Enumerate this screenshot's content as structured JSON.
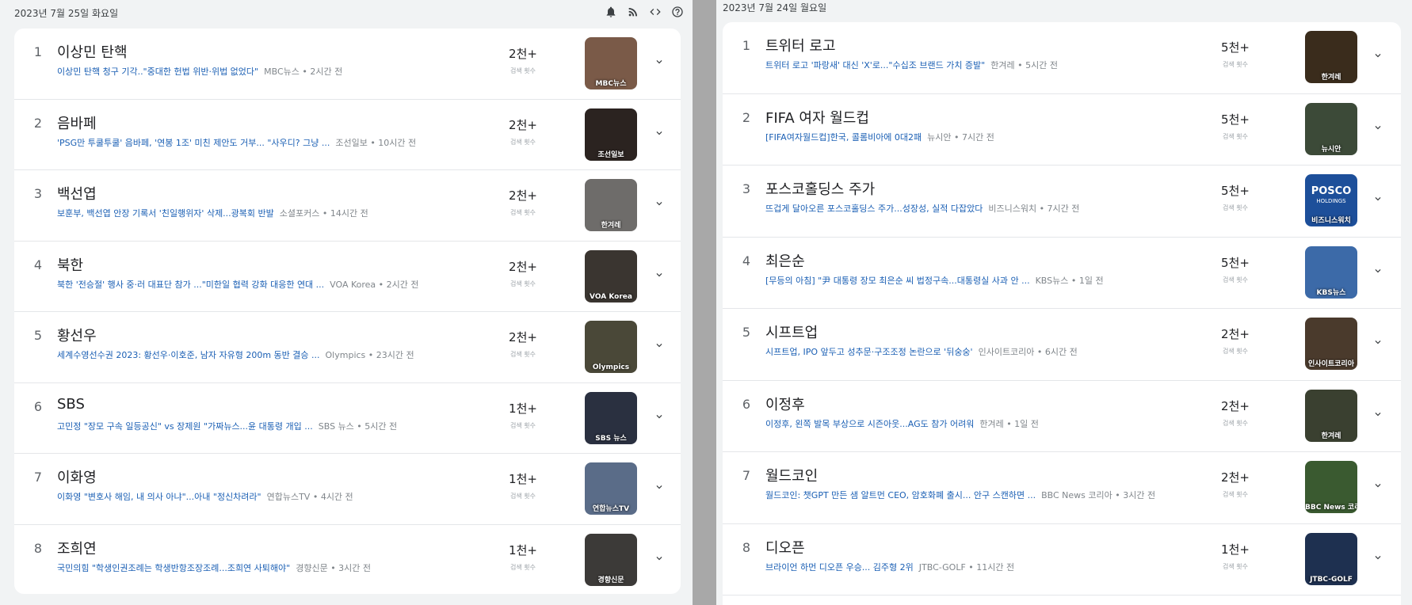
{
  "left": {
    "date": "2023년 7월 25일 화요일",
    "count_label": "검색 횟수",
    "items": [
      {
        "rank": "1",
        "title": "이상민 탄핵",
        "headline": "이상민 탄핵 청구 기각..\"중대한 헌법 위반·위법 없었다\"",
        "meta": "MBC뉴스 • 2시간 전",
        "count": "2천+",
        "thumb_source": "MBC뉴스",
        "thumb_color": "#7a5a48"
      },
      {
        "rank": "2",
        "title": "음바페",
        "headline": "'PSG만 투쿨투쿨' 음바페, '연봉 1조' 미친 제안도 거부... \"사우디? 그냥 ...",
        "meta": "조선일보 • 10시간 전",
        "count": "2천+",
        "thumb_source": "조선일보",
        "thumb_color": "#2b2320"
      },
      {
        "rank": "3",
        "title": "백선엽",
        "headline": "보훈부, 백선엽 안장 기록서 '친일행위자' 삭제...광복회 반발",
        "meta": "소셜포커스 • 14시간 전",
        "count": "2천+",
        "thumb_source": "한겨레",
        "thumb_color": "#6e6c6a"
      },
      {
        "rank": "4",
        "title": "북한",
        "headline": "북한 '전승절' 행사 중·러 대표단 참가 ...\"미한일 협력 강화 대응한 연대 ...",
        "meta": "VOA Korea • 2시간 전",
        "count": "2천+",
        "thumb_source": "VOA Korea",
        "thumb_color": "#3a3530"
      },
      {
        "rank": "5",
        "title": "황선우",
        "headline": "세계수영선수권 2023: 황선우·이호준, 남자 자유형 200m 동반 결승 ...",
        "meta": "Olympics • 23시간 전",
        "count": "2천+",
        "thumb_source": "Olympics",
        "thumb_color": "#4a4838"
      },
      {
        "rank": "6",
        "title": "SBS",
        "headline": "고민정 \"장모 구속 일등공신\" vs 장제원 \"가짜뉴스...윤 대통령 개입 ...",
        "meta": "SBS 뉴스 • 5시간 전",
        "count": "1천+",
        "thumb_source": "SBS 뉴스",
        "thumb_color": "#2a3040"
      },
      {
        "rank": "7",
        "title": "이화영",
        "headline": "이화영 \"변호사 해임, 내 의사 아냐\"...아내 \"정신차려라\"",
        "meta": "연합뉴스TV • 4시간 전",
        "count": "1천+",
        "thumb_source": "연합뉴스TV",
        "thumb_color": "#5a6c88"
      },
      {
        "rank": "8",
        "title": "조희연",
        "headline": "국민의힘 \"학생인권조례는 학생반항조장조례...조희연 사퇴해야\"",
        "meta": "경향신문 • 3시간 전",
        "count": "1천+",
        "thumb_source": "경향신문",
        "thumb_color": "#3c3a38"
      }
    ]
  },
  "right": {
    "date": "2023년 7월 24일 월요일",
    "count_label": "검색 횟수",
    "items": [
      {
        "rank": "1",
        "title": "트위터 로고",
        "headline": "트위터 로고 '파랑새' 대신 'X'로...\"수십조 브랜드 가치 증발\"",
        "meta": "한겨레 • 5시간 전",
        "count": "5천+",
        "thumb_source": "한겨레",
        "thumb_color": "#3a2c1c"
      },
      {
        "rank": "2",
        "title": "FIFA 여자 월드컵",
        "headline": "[FIFA여자월드컵]한국, 콜롬비아에 0대2패",
        "meta": "뉴시안 • 7시간 전",
        "count": "5천+",
        "thumb_source": "뉴시안",
        "thumb_color": "#3c4a38"
      },
      {
        "rank": "3",
        "title": "포스코홀딩스 주가",
        "headline": "뜨겁게 달아오른 포스코홀딩스 주가...성장성, 실적 다잡았다",
        "meta": "비즈니스워치 • 7시간 전",
        "count": "5천+",
        "thumb_source": "비즈니스워치",
        "thumb_color": "#1d4f9a",
        "thumb_logo": "POSCO",
        "thumb_logo_sub": "HOLDINGS"
      },
      {
        "rank": "4",
        "title": "최은순",
        "headline": "[무등의 아침] \"尹 대통령 장모 최은순 씨 법정구속...대통령실 사과 안 ...",
        "meta": "KBS뉴스 • 1일 전",
        "count": "5천+",
        "thumb_source": "KBS뉴스",
        "thumb_color": "#3c6aa8"
      },
      {
        "rank": "5",
        "title": "시프트업",
        "headline": "시프트업, IPO 앞두고 성추문·구조조정 논란으로 '뒤숭숭'",
        "meta": "인사이트코리아 • 6시간 전",
        "count": "2천+",
        "thumb_source": "인사이트코리아",
        "thumb_color": "#4a3a2c"
      },
      {
        "rank": "6",
        "title": "이정후",
        "headline": "이정후, 왼쪽 발목 부상으로 시즌아웃...AG도 참가 어려워",
        "meta": "한겨레 • 1일 전",
        "count": "2천+",
        "thumb_source": "한겨레",
        "thumb_color": "#3a4030"
      },
      {
        "rank": "7",
        "title": "월드코인",
        "headline": "월드코인: 챗GPT 만든 샘 알트먼 CEO, 암호화폐 출시... 안구 스캔하면 ...",
        "meta": "BBC News 코리아 • 3시간 전",
        "count": "2천+",
        "thumb_source": "BBC News 코리아",
        "thumb_color": "#3a5a30"
      },
      {
        "rank": "8",
        "title": "디오픈",
        "headline": "브라이언 하먼 디오픈 우승... 김주형 2위",
        "meta": "JTBC-GOLF • 11시간 전",
        "count": "1천+",
        "thumb_source": "JTBC-GOLF",
        "thumb_color": "#1e3050"
      }
    ]
  },
  "header_icons": [
    "bell-icon",
    "rss-icon",
    "code-icon",
    "help-icon"
  ]
}
